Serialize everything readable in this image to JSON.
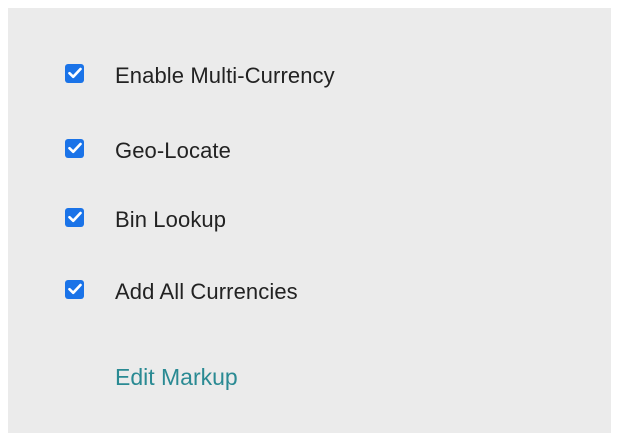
{
  "settings": {
    "options": [
      {
        "label": "Enable Multi-Currency",
        "checked": true,
        "icon": "checkmark-icon"
      },
      {
        "label": "Geo-Locate",
        "checked": true,
        "icon": "checkmark-icon"
      },
      {
        "label": "Bin Lookup",
        "checked": true,
        "icon": "checkmark-icon"
      },
      {
        "label": "Add All Currencies",
        "checked": true,
        "icon": "checkmark-icon"
      }
    ],
    "edit_link": "Edit Markup"
  },
  "colors": {
    "panel_background": "#ebebeb",
    "checkbox_fill": "#1a73e8",
    "label_text": "#222222",
    "link_text": "#2a8a93"
  }
}
